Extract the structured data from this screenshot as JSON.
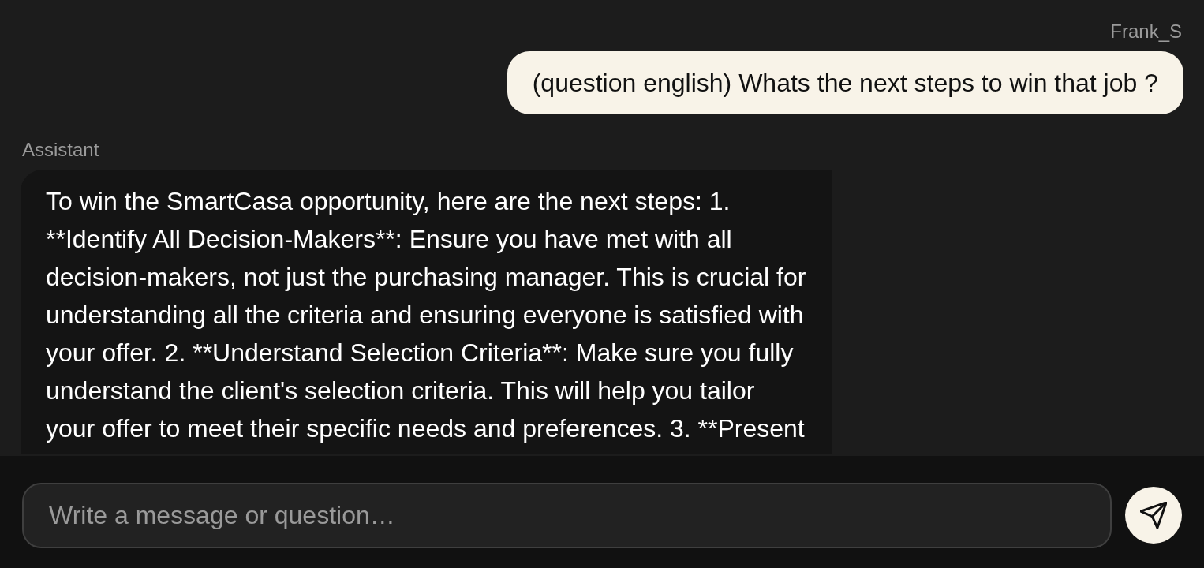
{
  "messages": [
    {
      "kind": "user",
      "sender": "Frank_S",
      "text": "(question english) Whats the next steps to win that job ?"
    },
    {
      "kind": "assistant",
      "sender": "Assistant",
      "text": "To win the SmartCasa opportunity, here are the next steps: 1. **Identify All Decision-Makers**: Ensure you have met with all decision-makers, not just the purchasing manager. This is crucial for understanding all the criteria and ensuring everyone is satisfied with your offer. 2. **Understand Selection Criteria**: Make sure you fully understand the client's selection criteria. This will help you tailor your offer to meet their specific needs and preferences. 3. **Present"
    }
  ],
  "composer": {
    "placeholder": "Write a message or question…"
  }
}
